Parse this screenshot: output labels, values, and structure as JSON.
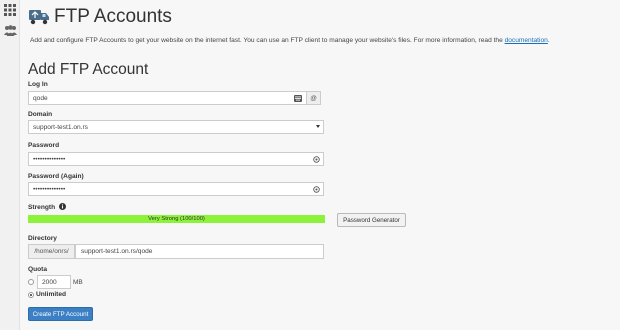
{
  "sidebar": {
    "items": [
      {
        "icon": "grid-icon"
      },
      {
        "icon": "users-icon"
      }
    ]
  },
  "header": {
    "title": "FTP Accounts",
    "icon": "ftp-truck-icon"
  },
  "description": {
    "text": "Add and configure FTP Accounts to get your website on the internet fast. You can use an FTP client to manage your website's files. For more information, read the ",
    "link": "documentation",
    "suffix": "."
  },
  "form": {
    "title": "Add FTP Account",
    "login": {
      "label": "Log In",
      "value": "qode",
      "addon": "@"
    },
    "domain": {
      "label": "Domain",
      "value": "support-test1.on.rs"
    },
    "password": {
      "label": "Password",
      "value": "••••••••••••••"
    },
    "password_again": {
      "label": "Password (Again)",
      "value": "••••••••••••••"
    },
    "strength": {
      "label": "Strength",
      "text": "Very Strong (100/100)",
      "value": 100
    },
    "generator_button": "Password Generator",
    "directory": {
      "label": "Directory",
      "prefix": "/home/onrs/",
      "value": "support-test1.on.rs/qode"
    },
    "quota": {
      "label": "Quota",
      "value": "2000",
      "unit": "MB",
      "unlimited_label": "Unlimited",
      "selected": "unlimited"
    },
    "submit_button": "Create FTP Account"
  },
  "colors": {
    "accent": "#3b7fc4",
    "strength": "#8cf23a",
    "link": "#1a6fb8"
  }
}
